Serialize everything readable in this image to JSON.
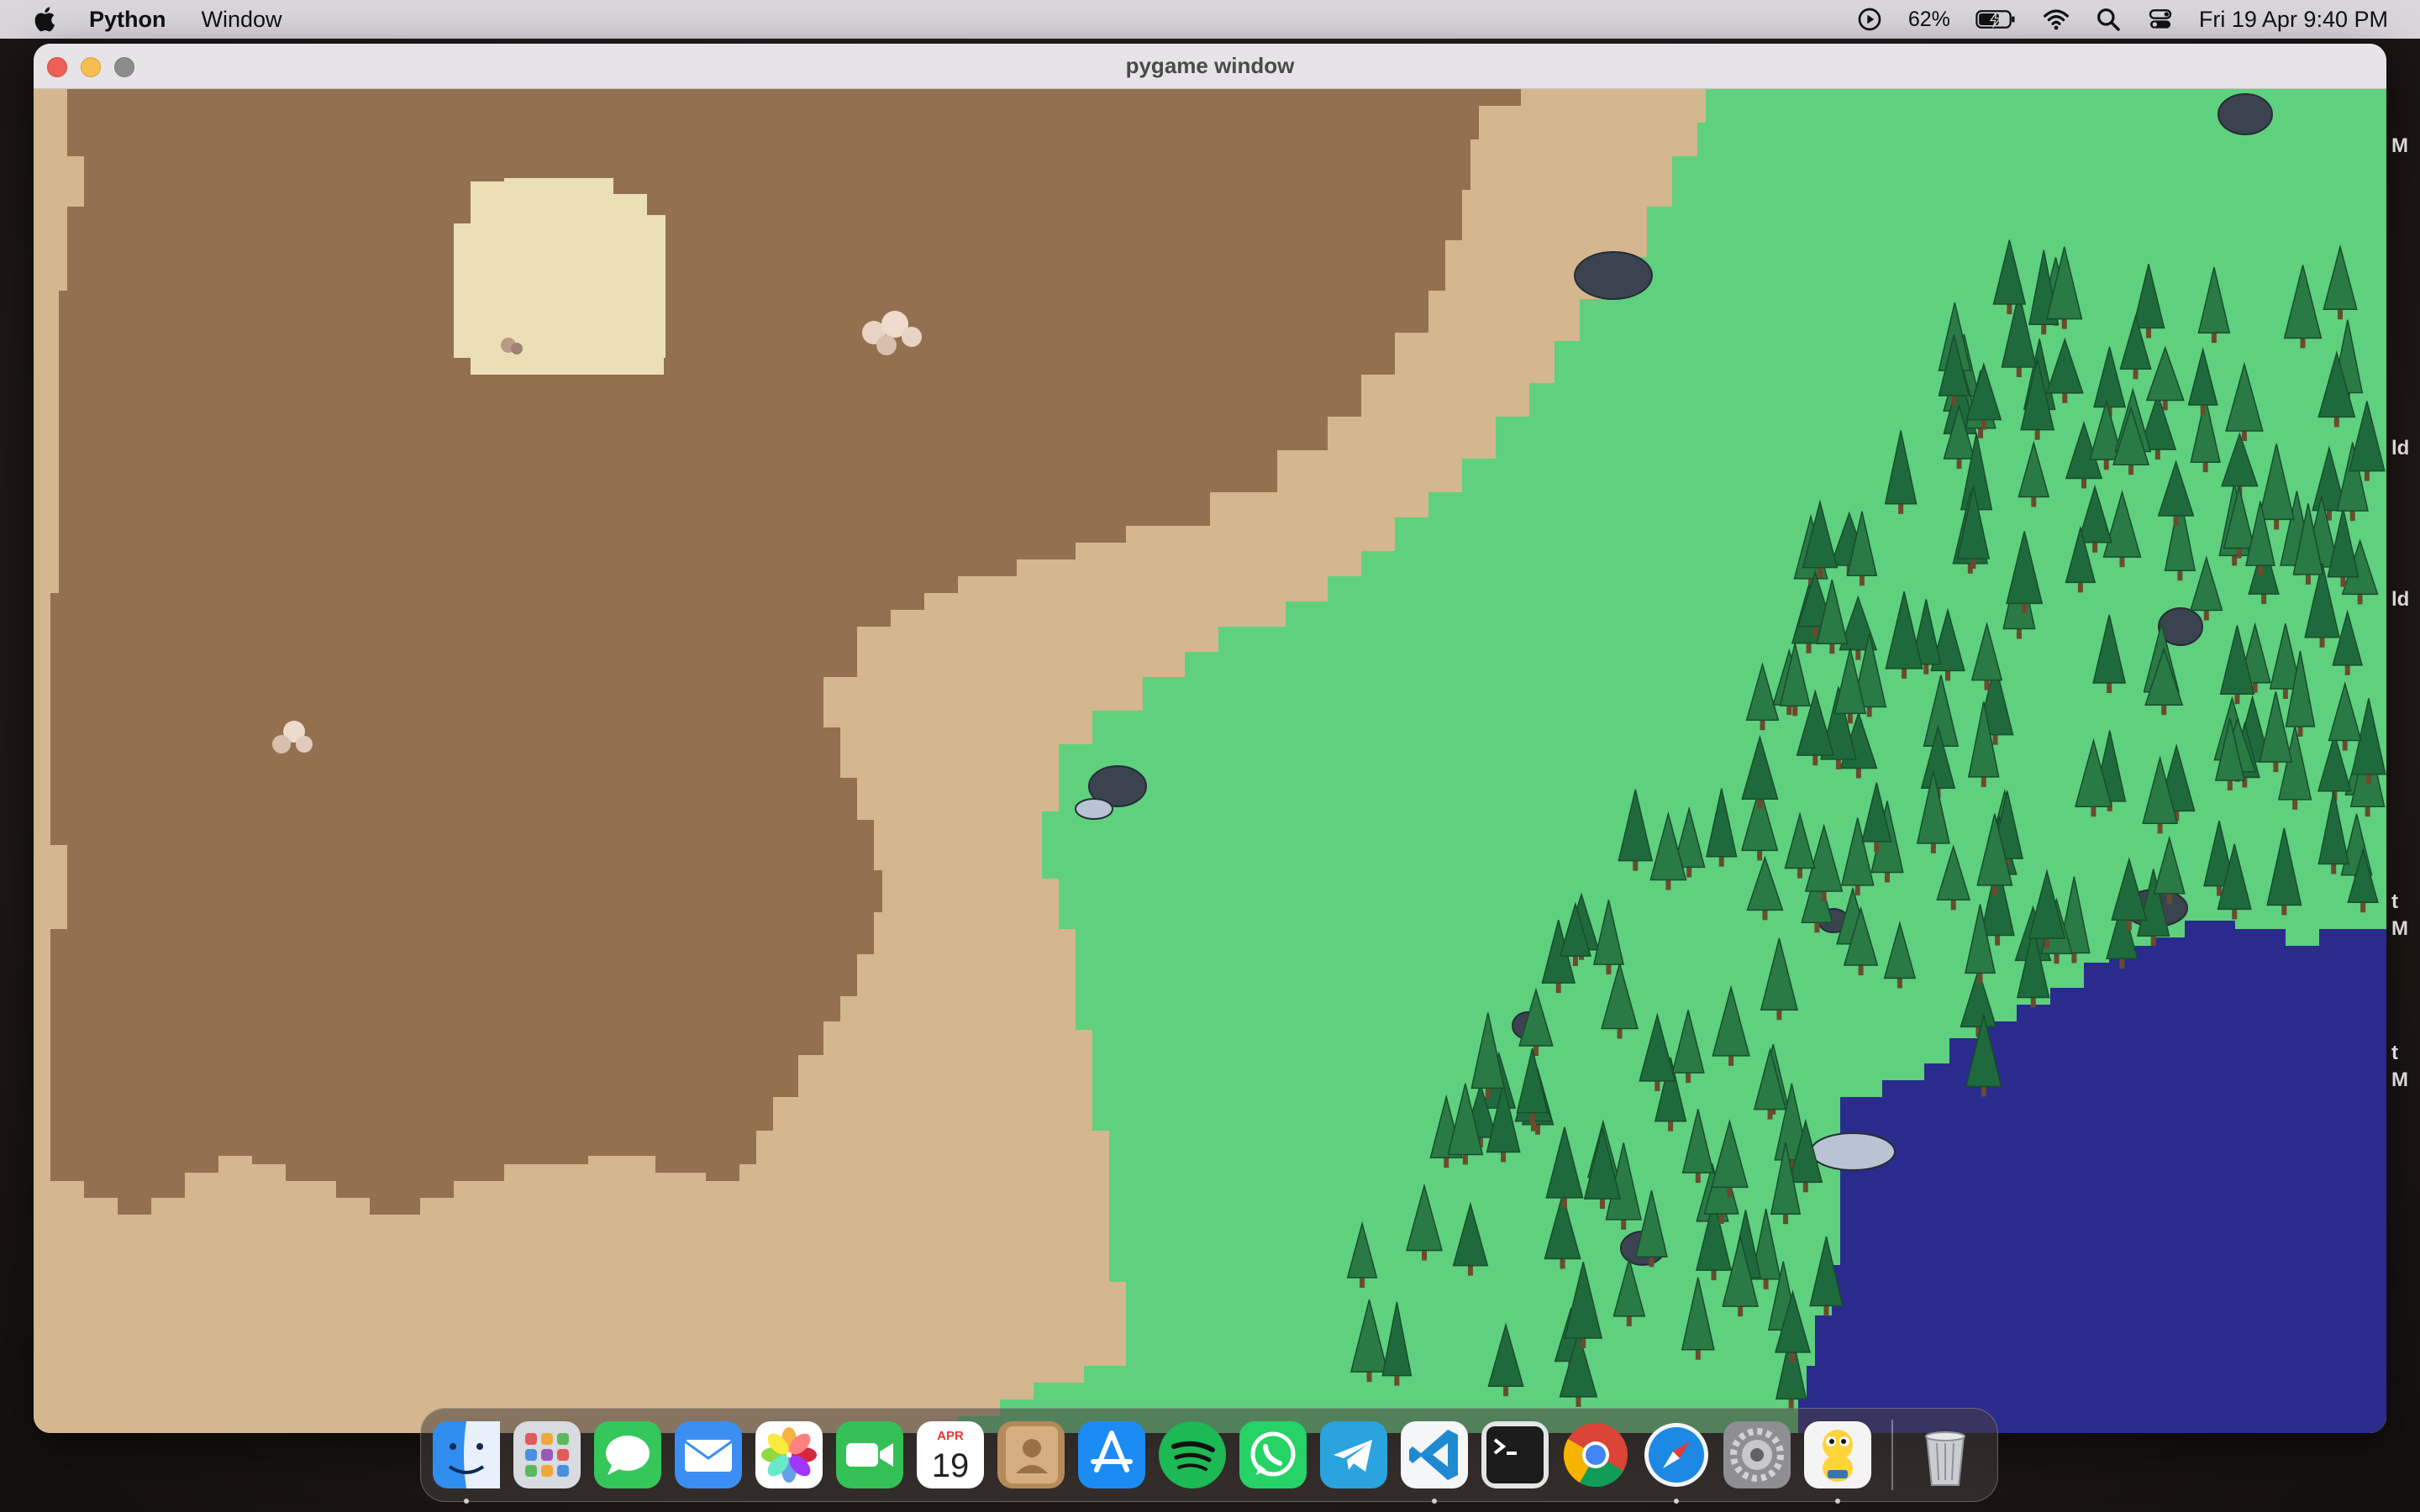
{
  "menubar": {
    "app_name": "Python",
    "menus": [
      "Window"
    ],
    "battery_percent": "62%",
    "datetime": "Fri 19 Apr  9:40 PM"
  },
  "window": {
    "title": "pygame window"
  },
  "background_window_fragments": [
    "M",
    "ld",
    "ld",
    "t",
    "M",
    "t",
    "M"
  ],
  "game": {
    "terrain_colors": {
      "dirt": "#93704f",
      "sand": "#d4b78e",
      "pale_sand": "#ebdfb8",
      "grass": "#5fd07e",
      "water": "#2a2b8c",
      "pine": "#1f6a3c",
      "rock": "#3b4350"
    }
  },
  "dock": {
    "apps": [
      {
        "name": "Finder",
        "icon": "finder-icon",
        "running": true
      },
      {
        "name": "Launchpad",
        "icon": "launchpad-icon",
        "running": false
      },
      {
        "name": "Messages",
        "icon": "messages-icon",
        "running": false
      },
      {
        "name": "Mail",
        "icon": "mail-icon",
        "running": false
      },
      {
        "name": "Photos",
        "icon": "photos-icon",
        "running": false
      },
      {
        "name": "FaceTime",
        "icon": "facetime-icon",
        "running": false
      },
      {
        "name": "Calendar",
        "icon": "calendar-icon",
        "running": false,
        "month": "APR",
        "day": "19"
      },
      {
        "name": "Contacts",
        "icon": "contacts-icon",
        "running": false
      },
      {
        "name": "App Store",
        "icon": "app-store-icon",
        "running": false
      },
      {
        "name": "Spotify",
        "icon": "spotify-icon",
        "running": false
      },
      {
        "name": "WhatsApp",
        "icon": "whatsapp-icon",
        "running": false
      },
      {
        "name": "Telegram",
        "icon": "telegram-icon",
        "running": false
      },
      {
        "name": "Visual Studio Code",
        "icon": "vscode-icon",
        "running": true
      },
      {
        "name": "Terminal",
        "icon": "terminal-icon",
        "running": false
      },
      {
        "name": "Google Chrome",
        "icon": "chrome-icon",
        "running": false
      },
      {
        "name": "Safari",
        "icon": "safari-icon",
        "running": true
      },
      {
        "name": "System Settings",
        "icon": "settings-icon",
        "running": false
      },
      {
        "name": "Python Launcher",
        "icon": "python-launcher-icon",
        "running": true
      }
    ],
    "trash": {
      "name": "Trash",
      "icon": "trash-icon"
    }
  }
}
